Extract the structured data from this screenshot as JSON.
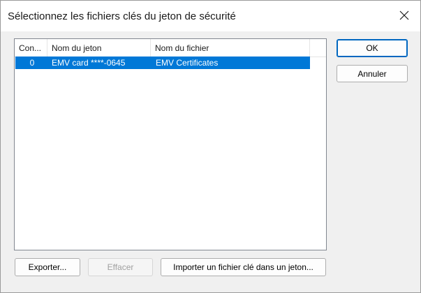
{
  "window": {
    "title": "Sélectionnez les fichiers clés du jeton de sécurité",
    "close_icon": "close-icon"
  },
  "table": {
    "columns": [
      "Con...",
      "Nom du jeton",
      "Nom du fichier"
    ],
    "rows": [
      {
        "container": "0",
        "token_name": "EMV card ****-0645",
        "file_name": "EMV Certificates",
        "selected": true
      }
    ]
  },
  "buttons": {
    "ok": "OK",
    "cancel": "Annuler",
    "export": "Exporter...",
    "delete": "Effacer",
    "import": "Importer un fichier clé dans un jeton..."
  },
  "colors": {
    "selection": "#0078d7",
    "default_button_border": "#0067c0",
    "disabled_text": "#a0a0a0"
  }
}
